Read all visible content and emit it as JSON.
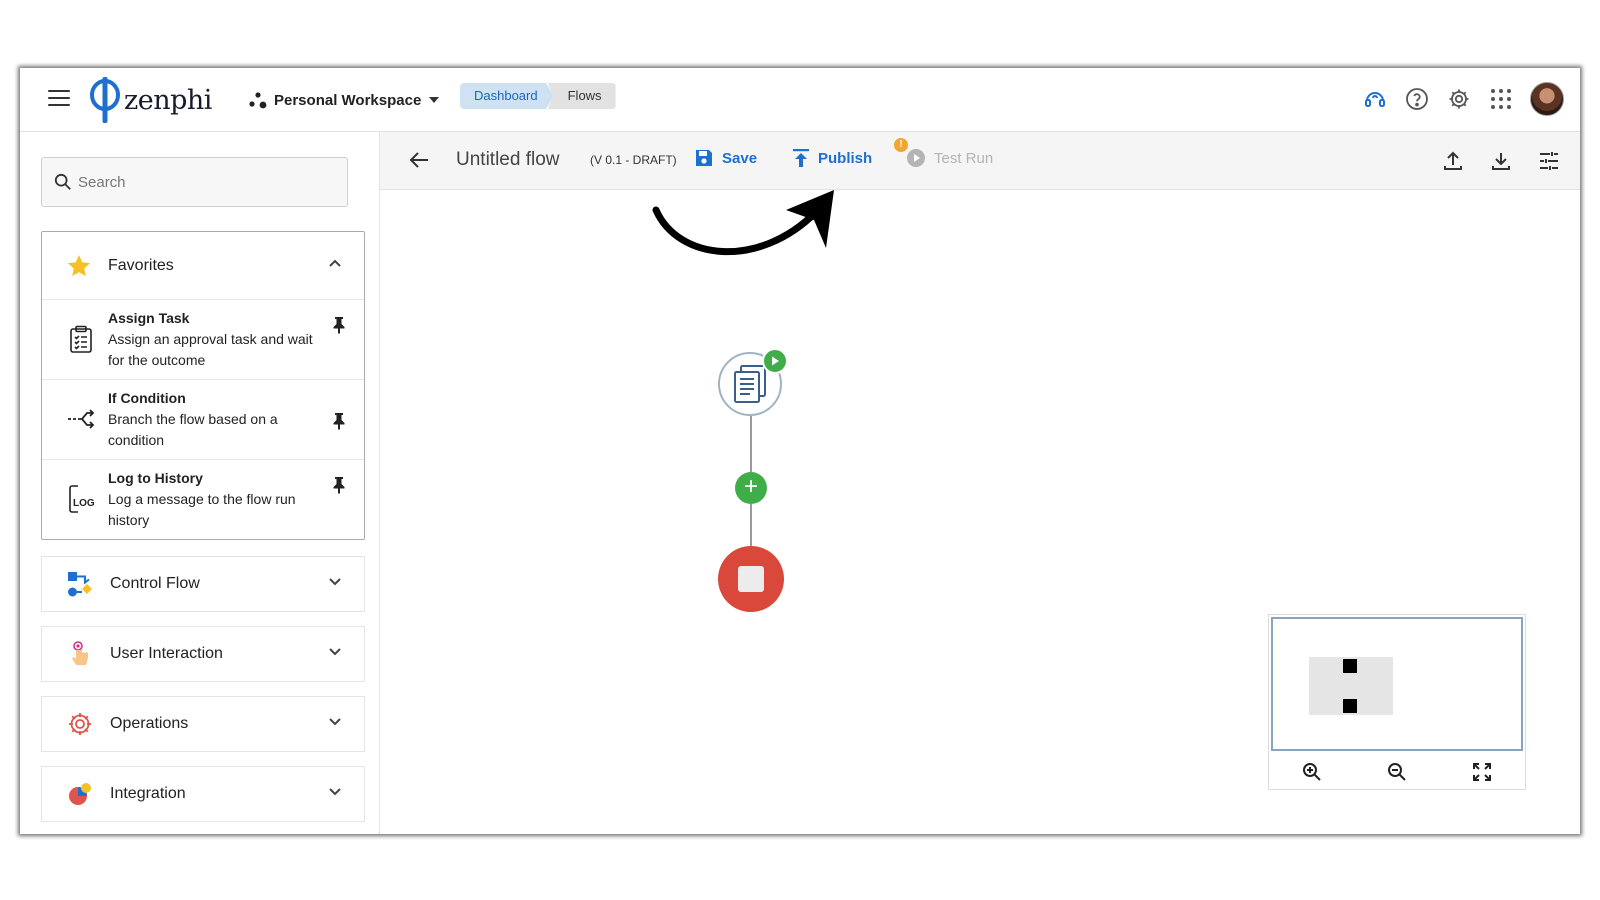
{
  "app": {
    "logo_text": "zenphi"
  },
  "header": {
    "workspace": "Personal Workspace",
    "breadcrumbs": [
      "Dashboard",
      "Flows"
    ]
  },
  "sidebar": {
    "search_placeholder": "Search",
    "favorites": {
      "label": "Favorites",
      "items": [
        {
          "title": "Assign Task",
          "desc": "Assign an approval task and wait for the outcome"
        },
        {
          "title": "If Condition",
          "desc": "Branch the flow based on a condition"
        },
        {
          "title": "Log to History",
          "desc": "Log a message to the flow run history",
          "icon_text": "LOG"
        }
      ]
    },
    "categories": [
      {
        "label": "Control Flow"
      },
      {
        "label": "User Interaction"
      },
      {
        "label": "Operations"
      },
      {
        "label": "Integration"
      }
    ]
  },
  "toolbar": {
    "title": "Untitled flow",
    "version": "(V 0.1 - DRAFT)",
    "save": "Save",
    "publish": "Publish",
    "test_run": "Test Run",
    "warning": "!"
  },
  "colors": {
    "accent_blue": "#1f6fd0",
    "start_green": "#3fae49",
    "end_red": "#d9483b",
    "warning_orange": "#f2a530"
  }
}
